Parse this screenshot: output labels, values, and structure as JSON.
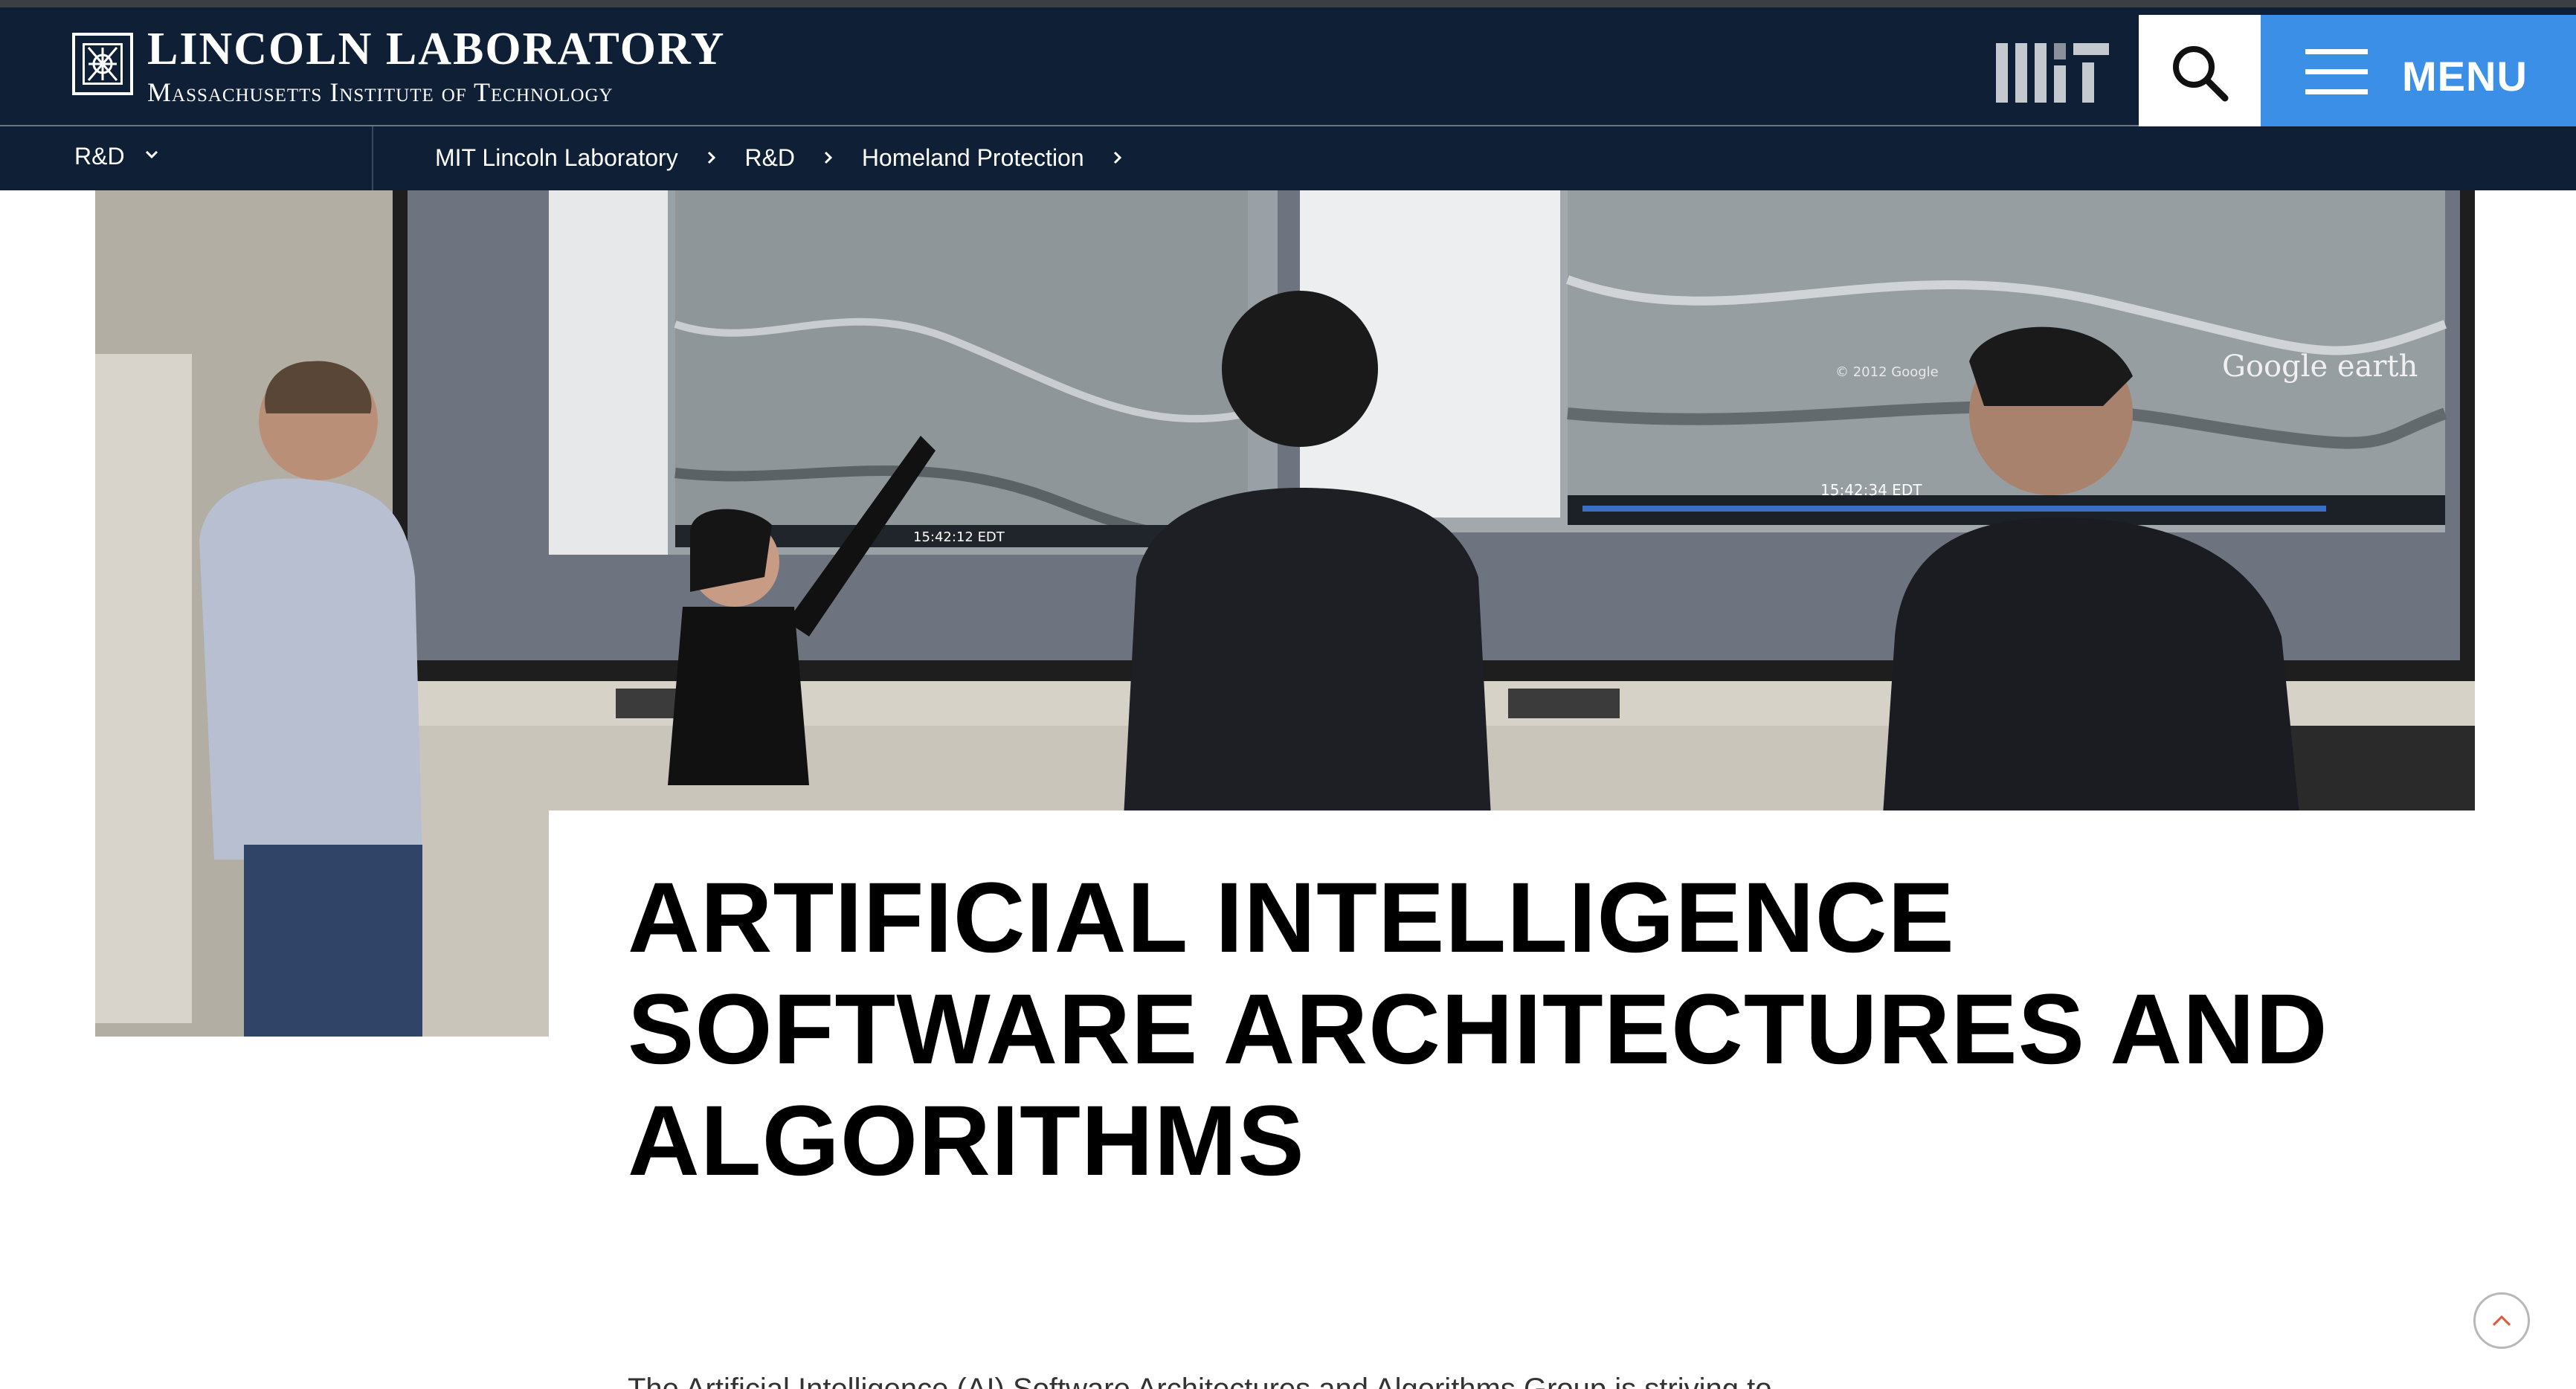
{
  "header": {
    "logo_title": "LINCOLN LABORATORY",
    "logo_subtitle": "Massachusetts Institute of Technology",
    "mit_logo": "mit-wordmark-icon",
    "search_icon": "search-icon",
    "menu_label": "MENU",
    "menu_icon": "hamburger-icon"
  },
  "subnav": {
    "section_label": "R&D",
    "breadcrumb": [
      "MIT Lincoln Laboratory",
      "R&D",
      "Homeland Protection"
    ]
  },
  "hero": {
    "screen_text": [
      "Google earth",
      "15:42:34 EDT",
      "15:42:12 EDT",
      "© 2012 Google"
    ]
  },
  "main": {
    "title": "ARTIFICIAL INTELLIGENCE SOFTWARE ARCHITECTURES AND ALGORITHMS",
    "intro_text": "The Artificial Intelligence (AI) Software Architectures and Algorithms Group is striving to"
  },
  "colors": {
    "nav_bg": "#0f1f36",
    "menu_blue": "#3b8fe6",
    "back_to_top": "#e0573a"
  }
}
